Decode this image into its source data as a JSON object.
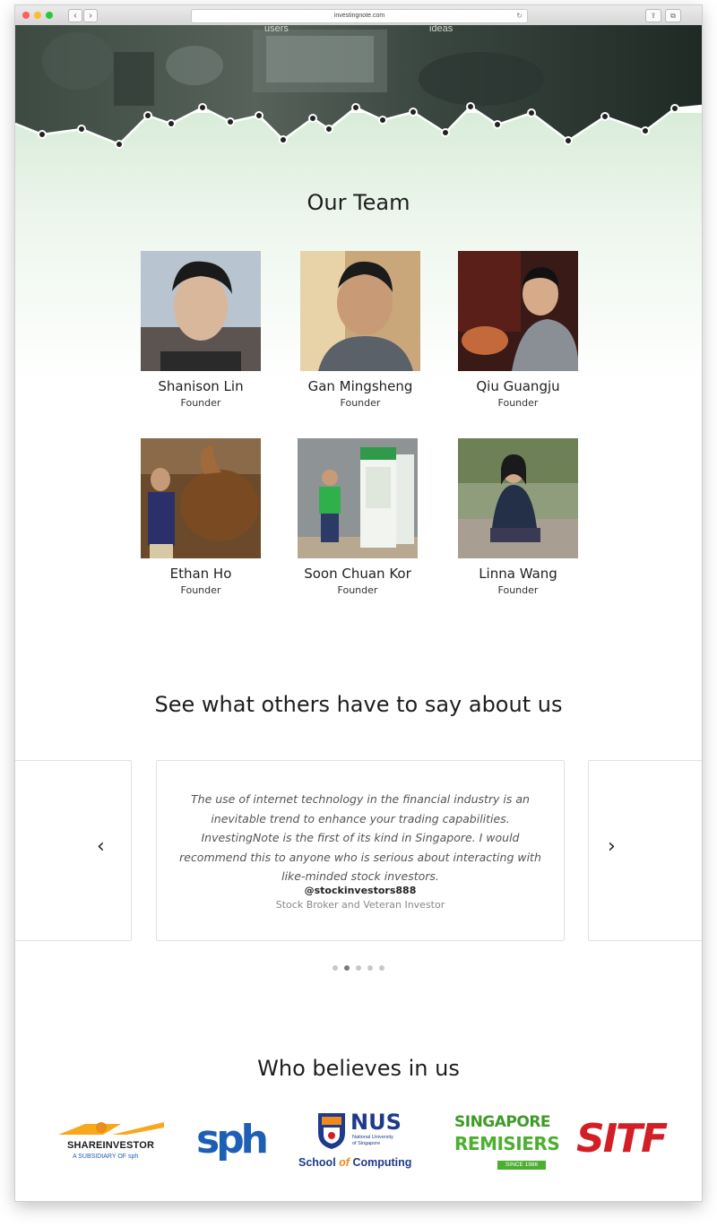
{
  "browser": {
    "url": "investingnote.com",
    "reload_icon": "reload-icon",
    "back_label": "‹",
    "forward_label": "›",
    "share_label": "⇪",
    "tabs_label": "⧉"
  },
  "hero": {
    "label_left": "users",
    "label_right": "ideas"
  },
  "team": {
    "title": "Our Team",
    "members": [
      {
        "name": "Shanison Lin",
        "role": "Founder"
      },
      {
        "name": "Gan Mingsheng",
        "role": "Founder"
      },
      {
        "name": "Qiu Guangju",
        "role": "Founder"
      },
      {
        "name": "Ethan Ho",
        "role": "Founder"
      },
      {
        "name": "Soon Chuan Kor",
        "role": "Founder"
      },
      {
        "name": "Linna Wang",
        "role": "Founder"
      }
    ]
  },
  "testimonials": {
    "title": "See what others have to say about us",
    "quote": "The use of internet technology in the financial industry is an inevitable trend to enhance your trading capabilities. InvestingNote is the first of its kind in Singapore. I would recommend this to anyone who is serious about interacting with like-minded stock investors.",
    "author": "@stockinvestors888",
    "author_role": "Stock Broker and Veteran Investor",
    "prev_label": "‹",
    "next_label": "›",
    "dot_count": 5,
    "active_dot": 2
  },
  "partners": {
    "title": "Who believes in us",
    "shareinvestor": {
      "name": "SHAREINVESTOR",
      "tag": "A SUBSIDIARY OF sph"
    },
    "sph": {
      "name": "sph"
    },
    "nus": {
      "name": "NUS",
      "sub1": "National University",
      "sub2": "of Singapore",
      "school_a": "School ",
      "school_b": "of",
      "school_c": " Computing"
    },
    "remisiers": {
      "line1": "SINGAPORE",
      "line2": "REMISIERS",
      "since": "SINCE 1986"
    },
    "sitf": {
      "name": "SITF"
    }
  },
  "colors": {
    "hero_dark": "#2d3a33",
    "mint": "#d9ecd9",
    "sph_blue": "#1d5fb5",
    "nus_blue": "#1f3a8a",
    "nus_orange": "#f08a1c",
    "remisier_green": "#4caf2f",
    "sitf_red": "#d21e25"
  }
}
